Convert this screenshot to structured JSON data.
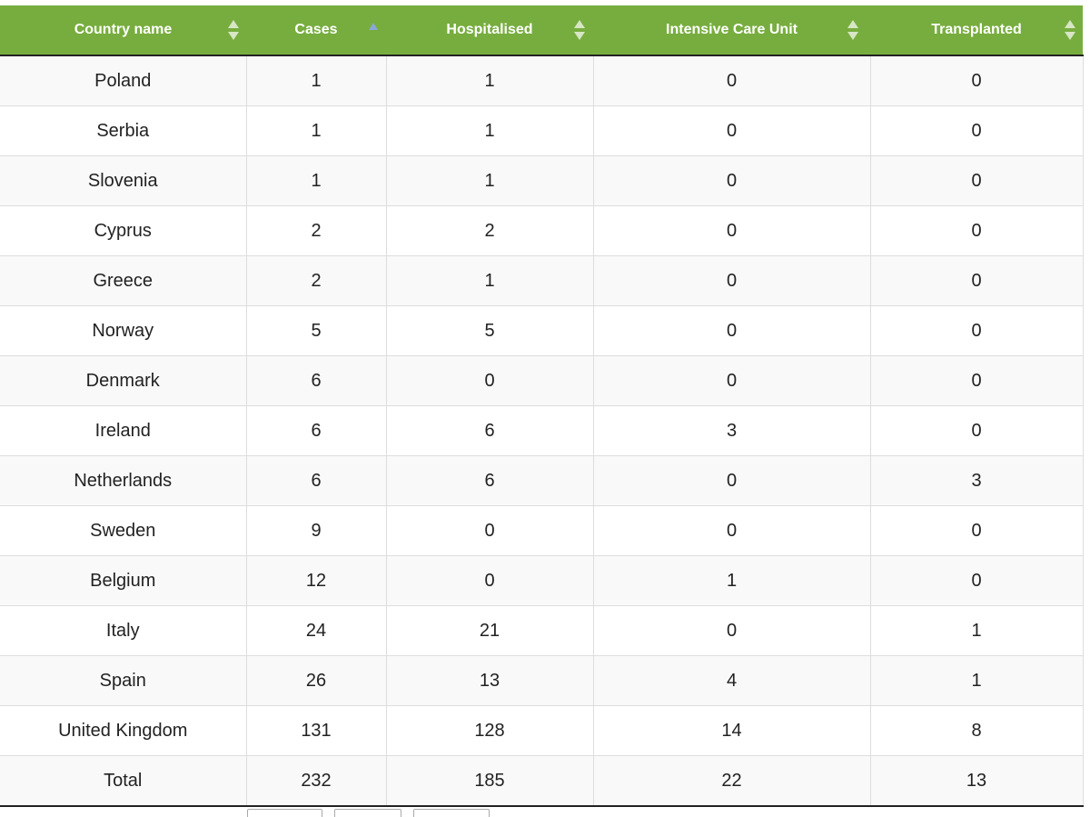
{
  "table": {
    "columns": [
      {
        "label": "Country name",
        "sort": "none"
      },
      {
        "label": "Cases",
        "sort": "ascending"
      },
      {
        "label": "Hospitalised",
        "sort": "none"
      },
      {
        "label": "Intensive Care Unit",
        "sort": "none"
      },
      {
        "label": "Transplanted",
        "sort": "none"
      }
    ],
    "rows": [
      {
        "country": "Poland",
        "cases": "1",
        "hospitalised": "1",
        "icu": "0",
        "transplanted": "0"
      },
      {
        "country": "Serbia",
        "cases": "1",
        "hospitalised": "1",
        "icu": "0",
        "transplanted": "0"
      },
      {
        "country": "Slovenia",
        "cases": "1",
        "hospitalised": "1",
        "icu": "0",
        "transplanted": "0"
      },
      {
        "country": "Cyprus",
        "cases": "2",
        "hospitalised": "2",
        "icu": "0",
        "transplanted": "0"
      },
      {
        "country": "Greece",
        "cases": "2",
        "hospitalised": "1",
        "icu": "0",
        "transplanted": "0"
      },
      {
        "country": "Norway",
        "cases": "5",
        "hospitalised": "5",
        "icu": "0",
        "transplanted": "0"
      },
      {
        "country": "Denmark",
        "cases": "6",
        "hospitalised": "0",
        "icu": "0",
        "transplanted": "0"
      },
      {
        "country": "Ireland",
        "cases": "6",
        "hospitalised": "6",
        "icu": "3",
        "transplanted": "0"
      },
      {
        "country": "Netherlands",
        "cases": "6",
        "hospitalised": "6",
        "icu": "0",
        "transplanted": "3"
      },
      {
        "country": "Sweden",
        "cases": "9",
        "hospitalised": "0",
        "icu": "0",
        "transplanted": "0"
      },
      {
        "country": "Belgium",
        "cases": "12",
        "hospitalised": "0",
        "icu": "1",
        "transplanted": "0"
      },
      {
        "country": "Italy",
        "cases": "24",
        "hospitalised": "21",
        "icu": "0",
        "transplanted": "1"
      },
      {
        "country": "Spain",
        "cases": "26",
        "hospitalised": "13",
        "icu": "4",
        "transplanted": "1"
      },
      {
        "country": "United Kingdom",
        "cases": "131",
        "hospitalised": "128",
        "icu": "14",
        "transplanted": "8"
      }
    ],
    "total": {
      "country": "Total",
      "cases": "232",
      "hospitalised": "185",
      "icu": "22",
      "transplanted": "13"
    }
  },
  "theme": {
    "header_bg": "#77ad3e",
    "header_text": "#ffffff",
    "sort_icon": "#d7e6c4",
    "sort_active_icon": "#8aa6d8"
  }
}
